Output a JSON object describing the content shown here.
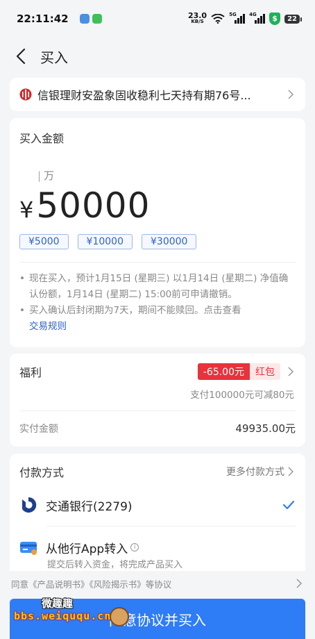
{
  "status_bar": {
    "time": "22:11:42",
    "net_speed_value": "23.0",
    "net_speed_unit": "KB/S",
    "signal1_tag": "5G",
    "signal2_tag": "4G",
    "shield_text": "$",
    "battery": "22"
  },
  "nav": {
    "title": "买入"
  },
  "product": {
    "name": "信银理财安盈象固收稳利七天持有期76号..."
  },
  "amount": {
    "section_title": "买入金额",
    "unit_hint": "万",
    "currency": "¥",
    "value": "50000",
    "chips": [
      "¥5000",
      "¥10000",
      "¥30000"
    ],
    "notes": [
      {
        "text": "现在买入，预计1月15日 (星期三) 以1月14日 (星期二) 净值确认份额，1月14日 (星期二) 15:00前可申请撤销。",
        "link": ""
      },
      {
        "text": "买入确认后封闭期为7天，期间不能赎回。点击查看",
        "link": "交易规则"
      }
    ]
  },
  "welfare": {
    "title": "福利",
    "coupon_amount": "-65.00元",
    "coupon_type": "红包",
    "subtitle": "支付100000元可减80元",
    "paid_label": "实付金额",
    "paid_value": "49935.00元"
  },
  "payment": {
    "title": "付款方式",
    "more": "更多付款方式",
    "bank_label": "交通银行(2279)",
    "transfer_label": "从他行App转入",
    "transfer_sub": "提交后转入资金，将完成产品买入"
  },
  "agreement": {
    "text": "同意《产品说明书》《风险揭示书》等协议"
  },
  "buy_button": {
    "label": "同意协议并买入"
  },
  "watermark": {
    "top": "微趣趣",
    "bottom": "bbs.weiququ.cn"
  },
  "colors": {
    "accent": "#2e7cf6",
    "link": "#2c63c8",
    "coupon_red": "#e8323c"
  }
}
